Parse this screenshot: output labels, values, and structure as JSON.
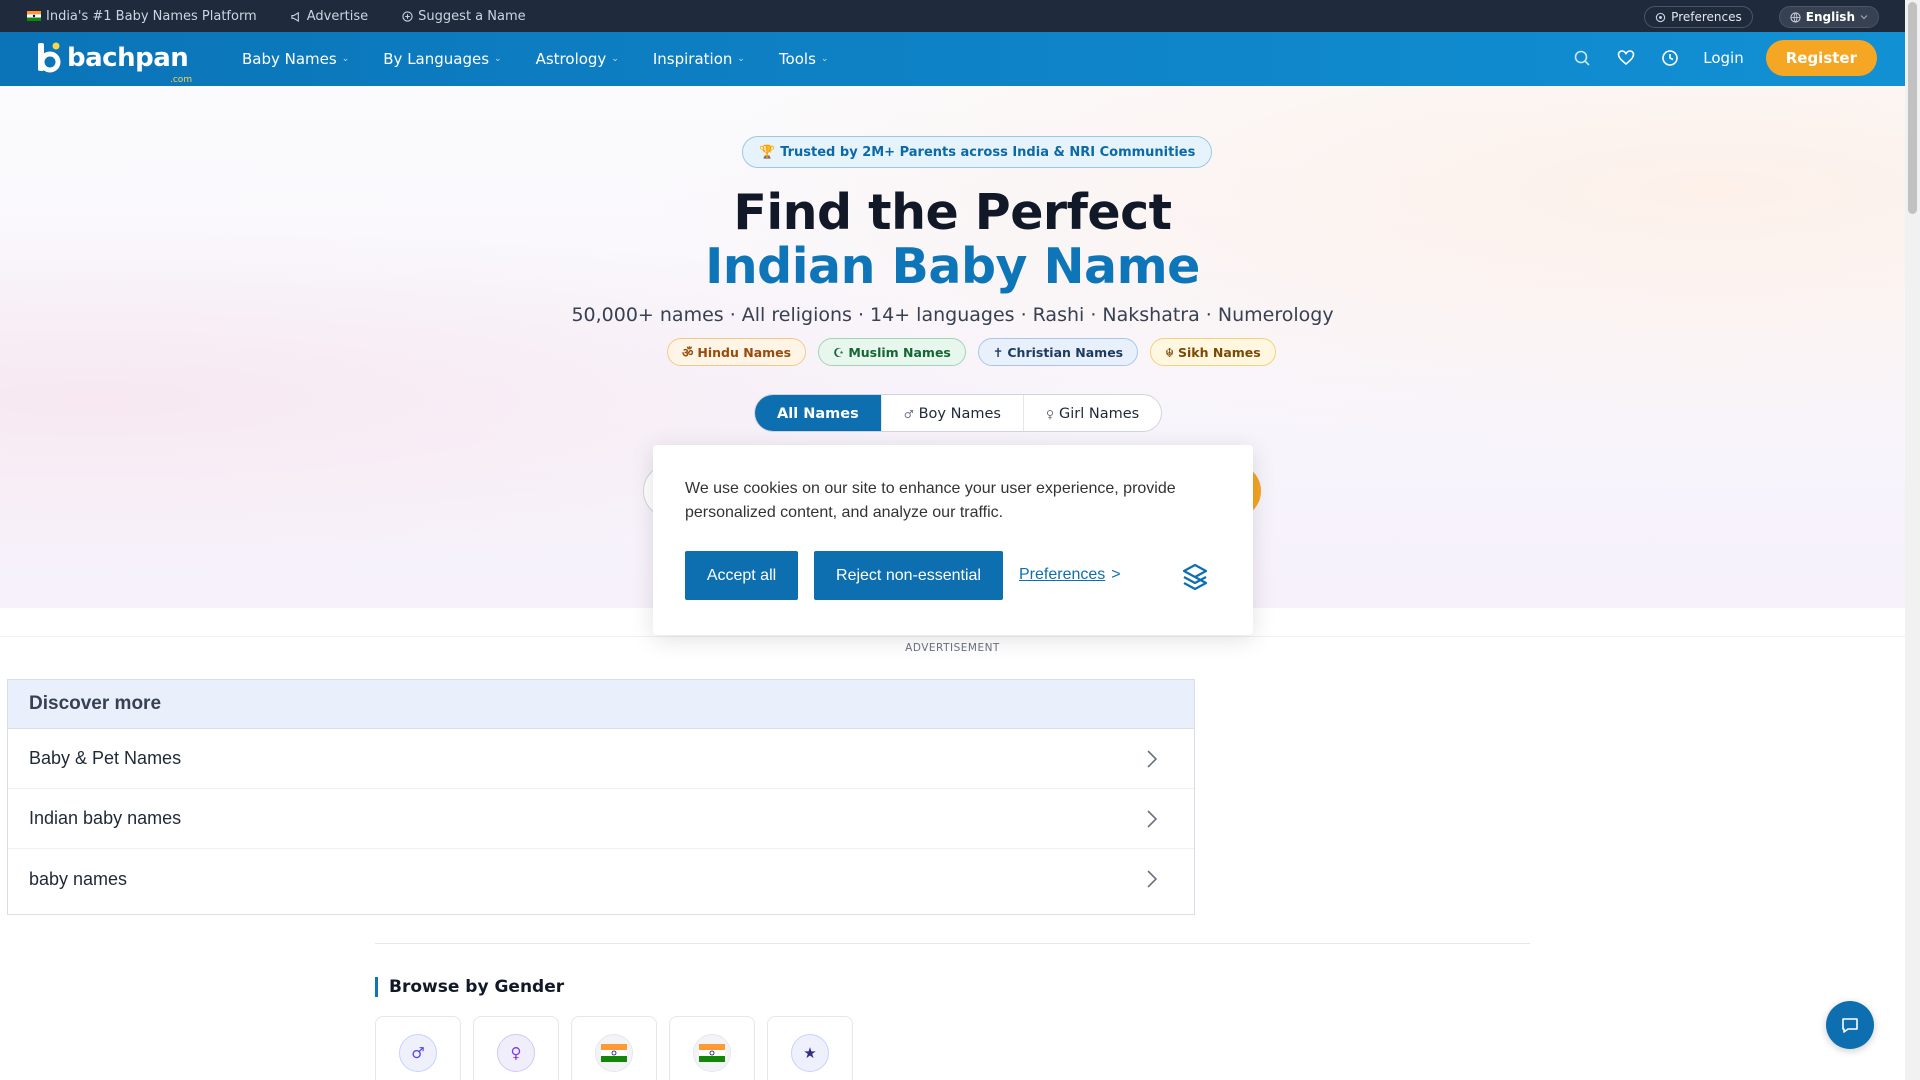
{
  "topbar": {
    "flag_icon": "india-flag-icon",
    "platform": "India's #1 Baby Names Platform",
    "advertise": "Advertise",
    "suggest": "Suggest a Name",
    "preferences": "Preferences",
    "language": "English"
  },
  "nav": {
    "logo_word": "bachpan",
    "logo_com": ".com",
    "links": [
      "Baby Names",
      "By Languages",
      "Astrology",
      "Inspiration",
      "Tools"
    ],
    "login": "Login",
    "register": "Register"
  },
  "hero": {
    "trust_badge": "Trusted by 2M+ Parents across India & NRI Communities",
    "title_line1": "Find the Perfect",
    "title_line2": "Indian Baby Name",
    "subtitle": "50,000+ names · All religions · 14+ languages · Rashi · Nakshatra · Numerology",
    "religion_tags": [
      "Hindu Names",
      "Muslim Names",
      "Christian Names",
      "Sikh Names"
    ],
    "gender_tabs": [
      "All Names",
      "Boy Names",
      "Girl Names"
    ],
    "active_tab": "All Names"
  },
  "cookie": {
    "message": "We use cookies on our site to enhance your user experience, provide personalized content, and analyze our traffic.",
    "accept": "Accept all",
    "reject": "Reject non-essential",
    "preferences": "Preferences",
    "preferences_arrow": ">"
  },
  "ad": {
    "label": "ADVERTISEMENT",
    "discover_title": "Discover more",
    "items": [
      "Baby & Pet Names",
      "Indian baby names",
      "baby names"
    ]
  },
  "browse": {
    "title": "Browse by Gender",
    "cards": [
      "boy-icon",
      "girl-icon",
      "india-flag-icon",
      "india-flag-icon",
      "star-icon"
    ]
  },
  "colors": {
    "brand_blue": "#0e6fb0",
    "accent_orange": "#f5a623",
    "topbar": "#1f2b3d"
  }
}
